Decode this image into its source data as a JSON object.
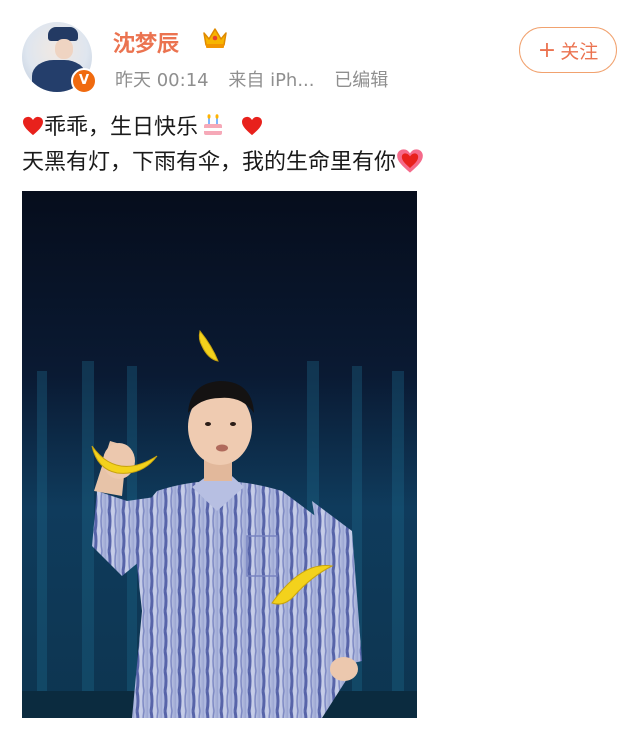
{
  "user": {
    "name": "沈梦辰",
    "verified_badge": "V"
  },
  "meta": {
    "time": "昨天 00:14",
    "source": "来自 iPh...",
    "edited": "已编辑"
  },
  "follow_button": {
    "plus": "+",
    "label": "关注"
  },
  "post": {
    "line1_a": "乖乖，生日快乐",
    "line2": "天黑有灯，下雨有伞，我的生命里有你"
  },
  "colors": {
    "username": "#eb7350",
    "meta": "#8f8f8f",
    "text": "#1a1a1a",
    "follow_border": "#f1a26f"
  },
  "icons": [
    "crown-icon",
    "heart-icon",
    "birthday-cake-icon",
    "sparkling-heart-icon",
    "verified-badge-icon"
  ]
}
